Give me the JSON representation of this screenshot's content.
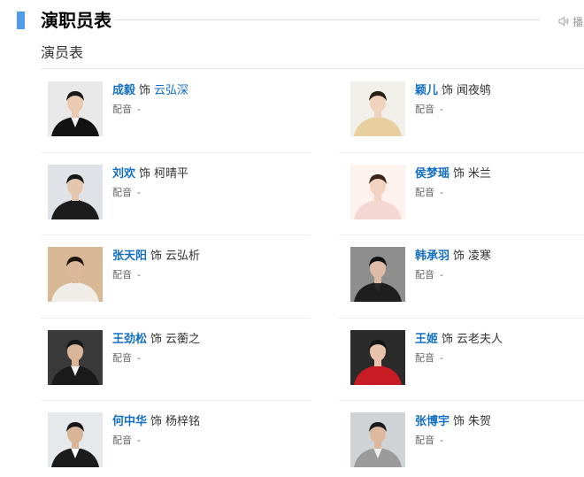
{
  "header": {
    "title": "演职员表",
    "audio_label": "播"
  },
  "subtitle": "演员表",
  "cast": [
    {
      "actor": "成毅",
      "as": "饰",
      "role": "云弘深",
      "role_link": true,
      "dub_label": "配音",
      "dub_value": "-",
      "photo": {
        "bg": "#e8e8e8",
        "coat": "#121212",
        "skin": "#e9c9b0",
        "hair": "#1a1a1a",
        "shirt": "#f2f2f2"
      }
    },
    {
      "actor": "颖儿",
      "as": "饰",
      "role": "闻夜鸲",
      "role_link": false,
      "dub_label": "配音",
      "dub_value": "-",
      "photo": {
        "bg": "#f1efe9",
        "coat": "#e8cf9e",
        "skin": "#f0d2bd",
        "hair": "#2a2018",
        "shirt": "#e8cf9e"
      }
    },
    {
      "actor": "刘欢",
      "as": "饰",
      "role": "柯晴平",
      "role_link": false,
      "dub_label": "配音",
      "dub_value": "-",
      "photo": {
        "bg": "#dfe3e7",
        "coat": "#1c1c1c",
        "skin": "#e4c6ae",
        "hair": "#151515",
        "shirt": "#1c1c1c"
      }
    },
    {
      "actor": "侯梦瑶",
      "as": "饰",
      "role": "米兰",
      "role_link": false,
      "dub_label": "配音",
      "dub_value": "-",
      "photo": {
        "bg": "#fdf2ee",
        "coat": "#f4d6d2",
        "skin": "#f3d3c0",
        "hair": "#3a2418",
        "shirt": "#f4d6d2"
      }
    },
    {
      "actor": "张天阳",
      "as": "饰",
      "role": "云弘析",
      "role_link": false,
      "dub_label": "配音",
      "dub_value": "-",
      "photo": {
        "bg": "#d8b894",
        "coat": "#f0ede8",
        "skin": "#dcb89a",
        "hair": "#1d1712",
        "shirt": "#f0ede8"
      }
    },
    {
      "actor": "韩承羽",
      "as": "饰",
      "role": "凌寒",
      "role_link": false,
      "dub_label": "配音",
      "dub_value": "-",
      "photo": {
        "bg": "#8e8e8e",
        "coat": "#1e1e1e",
        "skin": "#dcbca4",
        "hair": "#121212",
        "shirt": "#2a2a2a"
      }
    },
    {
      "actor": "王劲松",
      "as": "饰",
      "role": "云蘅之",
      "role_link": false,
      "dub_label": "配音",
      "dub_value": "-",
      "photo": {
        "bg": "#3a3a3a",
        "coat": "#1a1a1a",
        "skin": "#d9b59a",
        "hair": "#161616",
        "shirt": "#f5f5f5"
      }
    },
    {
      "actor": "王姬",
      "as": "饰",
      "role": "云老夫人",
      "role_link": false,
      "dub_label": "配音",
      "dub_value": "-",
      "photo": {
        "bg": "#2b2b2b",
        "coat": "#c81c24",
        "skin": "#e7c4ab",
        "hair": "#141414",
        "shirt": "#c81c24"
      }
    },
    {
      "actor": "何中华",
      "as": "饰",
      "role": "杨梓铭",
      "role_link": false,
      "dub_label": "配音",
      "dub_value": "-",
      "photo": {
        "bg": "#e6e9ec",
        "coat": "#1b1b1b",
        "skin": "#d8b498",
        "hair": "#141414",
        "shirt": "#ffffff"
      }
    },
    {
      "actor": "张博宇",
      "as": "饰",
      "role": "朱贺",
      "role_link": false,
      "dub_label": "配音",
      "dub_value": "-",
      "photo": {
        "bg": "#cfd3d6",
        "coat": "#9a9a9a",
        "skin": "#dcb99e",
        "hair": "#1a1a1a",
        "shirt": "#eeeeee"
      }
    }
  ]
}
